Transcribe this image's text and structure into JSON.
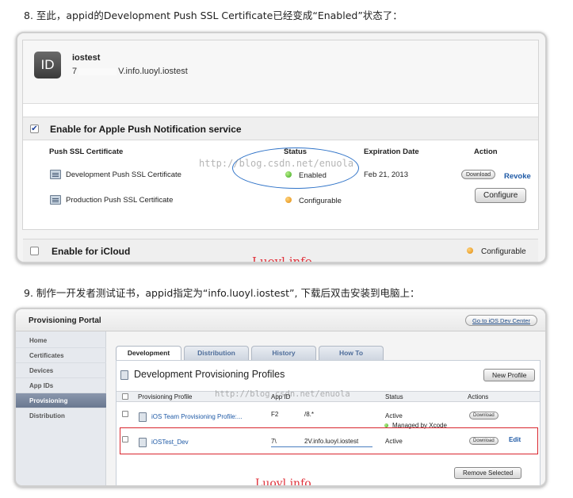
{
  "step8": {
    "text": "8. 至此，appid的Development Push SSL Certificate已经变成“Enabled”状态了："
  },
  "step9": {
    "text": "9. 制作一开发者测试证书，appid指定为“info.luoyl.iostest”, 下载后双击安装到电脑上："
  },
  "app": {
    "icon_text": "ID",
    "name": "iostest",
    "id_prefix": "7",
    "id_suffix": "V.info.luoyl.iostest"
  },
  "push": {
    "enable_label": "Enable for Apple Push Notification service",
    "checked": true,
    "headers": {
      "cert": "Push SSL Certificate",
      "status": "Status",
      "expiration": "Expiration Date",
      "action": "Action"
    },
    "rows": [
      {
        "name": "Development Push SSL Certificate",
        "status": "Enabled",
        "status_color": "#3aa51c",
        "expiration": "Feb 21, 2013",
        "download": "Download",
        "revoke": "Revoke"
      },
      {
        "name": "Production Push SSL Certificate",
        "status": "Configurable",
        "status_color": "#e08a0c",
        "configure": "Configure"
      }
    ]
  },
  "icloud": {
    "enable_label": "Enable for iCloud",
    "status": "Configurable"
  },
  "watermark": {
    "blog": "http://blog.csdn.net/enuola",
    "luoyl": "Luoyl.info"
  },
  "portal": {
    "title": "Provisioning Portal",
    "dev_center": "Go to iOS Dev Center",
    "sidebar": [
      "Home",
      "Certificates",
      "Devices",
      "App IDs",
      "Provisioning",
      "Distribution"
    ],
    "sidebar_active": "Provisioning",
    "tabs": [
      "Development",
      "Distribution",
      "History",
      "How To"
    ],
    "tab_active": "Development",
    "section_title": "Development Provisioning Profiles",
    "new_profile": "New Profile",
    "columns": {
      "profile": "Provisioning Profile",
      "app_id": "App ID",
      "status": "Status",
      "actions": "Actions"
    },
    "rows": [
      {
        "profile": "iOS Team Provisioning Profile:...",
        "app_id_prefix": "F2",
        "app_id_suffix": "/8.*",
        "status": "Active",
        "sub_status": "Managed by Xcode",
        "download": "Download"
      },
      {
        "profile": "iOSTest_Dev",
        "app_id_prefix": "7\\",
        "app_id_suffix": "2V.info.luoyl.iostest",
        "status": "Active",
        "download": "Download",
        "edit": "Edit"
      }
    ],
    "remove_selected": "Remove Selected"
  }
}
